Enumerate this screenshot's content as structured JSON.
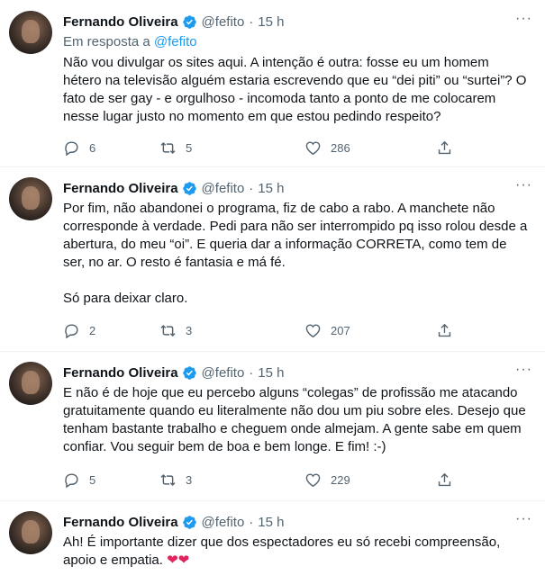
{
  "tweets": [
    {
      "name": "Fernando Oliveira",
      "handle": "@fefito",
      "dot": "·",
      "time": "15 h",
      "reply_prefix": "Em resposta a",
      "reply_handle": "@fefito",
      "paragraphs": [
        "Não vou divulgar os sites aqui. A intenção é outra: fosse eu um homem hétero na televisão alguém estaria escrevendo que eu “dei piti” ou “surtei”? O fato de ser gay - e orgulhoso - incomoda tanto a ponto de me colocarem nesse lugar justo no momento em que estou pedindo respeito?"
      ],
      "replies": "6",
      "retweets": "5",
      "likes": "286"
    },
    {
      "name": "Fernando Oliveira",
      "handle": "@fefito",
      "dot": "·",
      "time": "15 h",
      "paragraphs": [
        "Por fim, não abandonei o programa, fiz de cabo a rabo. A manchete não corresponde à verdade. Pedi para não ser interrompido pq isso rolou desde a abertura, do meu “oi”. E queria dar a informação CORRETA, como tem de ser, no ar. O resto é fantasia e má fé.",
        "Só para deixar claro."
      ],
      "replies": "2",
      "retweets": "3",
      "likes": "207"
    },
    {
      "name": "Fernando Oliveira",
      "handle": "@fefito",
      "dot": "·",
      "time": "15 h",
      "paragraphs": [
        "E não é de hoje que eu percebo alguns “colegas” de profissão me atacando gratuitamente quando eu literalmente não dou um piu sobre eles. Desejo que tenham bastante trabalho e cheguem onde almejam. A gente sabe em quem confiar. Vou seguir bem de boa e bem longe. E fim! :-)"
      ],
      "replies": "5",
      "retweets": "3",
      "likes": "229"
    },
    {
      "name": "Fernando Oliveira",
      "handle": "@fefito",
      "dot": "·",
      "time": "15 h",
      "paragraphs": [
        "Ah! É importante dizer que dos espectadores eu só recebi compreensão, apoio e empatia."
      ],
      "emoji": "❤❤"
    }
  ],
  "more_label": "···",
  "colors": {
    "accent": "#1d9bf0",
    "muted": "#536471",
    "heart": "#e0245e"
  },
  "icons": [
    "verified-badge-icon",
    "reply-icon",
    "retweet-icon",
    "like-icon",
    "share-icon",
    "more-icon"
  ]
}
